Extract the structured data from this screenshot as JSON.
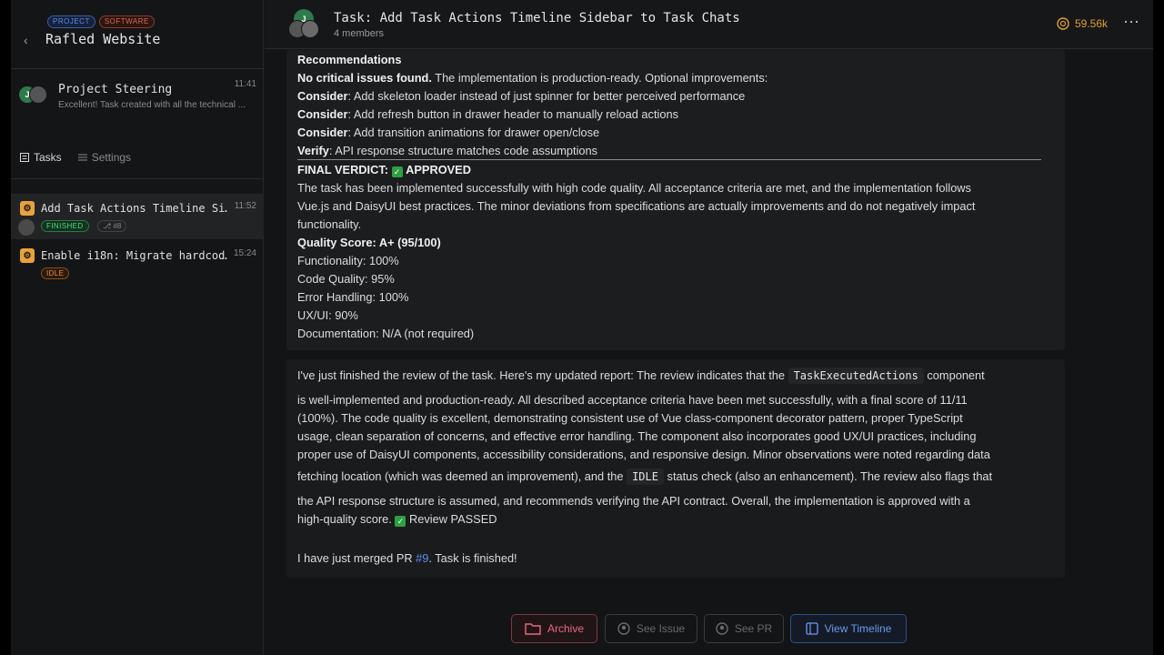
{
  "sidebar": {
    "chips": [
      "PROJECT",
      "SOFTWARE"
    ],
    "workspace_title": "Rafled Website",
    "steering": {
      "title": "Project Steering",
      "time": "11:41",
      "preview": "Excellent! Task created with all the technical ...",
      "avatar_initial": "J"
    },
    "tabs": [
      {
        "label": "Tasks"
      },
      {
        "label": "Settings"
      }
    ],
    "tasks": [
      {
        "title": "Add Task Actions Timeline Si…",
        "time": "11:52",
        "status": "FINISHED",
        "pr": "#8"
      },
      {
        "title": "Enable i18n: Migrate hardcod…",
        "time": "15:24",
        "status": "IDLE"
      }
    ]
  },
  "header": {
    "title": "Task: Add Task Actions Timeline Sidebar to Task Chats",
    "members": "4 members",
    "credits": "59.56k",
    "avatar_initial": "J"
  },
  "message1": {
    "recommendations_heading": "Recommendations",
    "no_issues_bold": "No critical issues found.",
    "no_issues_rest": " The implementation is production-ready. Optional improvements:",
    "items": [
      {
        "label": "Consider",
        "text": ": Add skeleton loader instead of just spinner for better perceived performance"
      },
      {
        "label": "Consider",
        "text": ": Add refresh button in drawer header to manually reload actions"
      },
      {
        "label": "Consider",
        "text": ": Add transition animations for drawer open/close"
      },
      {
        "label": "Verify",
        "text": ": API response structure matches code assumptions"
      }
    ],
    "verdict_label": "FINAL VERDICT:",
    "verdict_value": "APPROVED",
    "summary_lines": [
      "The task has been implemented successfully with high code quality. All acceptance criteria are met, and the implementation follows",
      "Vue.js and DaisyUI best practices. The minor deviations from specifications are actually improvements and do not negatively impact",
      "functionality."
    ],
    "quality_score": "Quality Score: A+ (95/100)",
    "scores": [
      "Functionality: 100%",
      "Code Quality: 95%",
      "Error Handling: 100%",
      "UX/UI: 90%",
      "Documentation: N/A (not required)"
    ]
  },
  "message2": {
    "l1_pre": "I've just finished the review of the task. Here's my updated report: The review indicates that the",
    "l1_code": "TaskExecutedActions",
    "l1_post": "component",
    "l2": "is well-implemented and production-ready. All described acceptance criteria have been met successfully, with a final score of 11/11",
    "l3": "(100%). The code quality is excellent, demonstrating consistent use of Vue class-component decorator pattern, proper TypeScript",
    "l4": "usage, clean separation of concerns, and effective error handling. The component also incorporates good UX/UI practices, including",
    "l5": "proper use of DaisyUI components, accessibility considerations, and responsive design. Minor observations were noted regarding data",
    "l6_pre": "fetching location (which was deemed an improvement), and the",
    "l6_code": "IDLE",
    "l6_post": "status check (also an enhancement). The review also flags that",
    "l7": "the API response structure is assumed, and recommends verifying the API contract. Overall, the implementation is approved with a",
    "l8_pre": "high-quality score.",
    "l8_post": "Review PASSED"
  },
  "message3": {
    "pre": "I have just merged PR ",
    "link": "#9",
    "post": ". Task is finished!"
  },
  "footer": {
    "archive": "Archive",
    "see_issue": "See Issue",
    "see_pr": "See PR",
    "view_timeline": "View Timeline"
  },
  "colors": {
    "accent_blue": "#5b8def",
    "finished_green": "#4ade80",
    "idle_orange": "#f08a3c",
    "archive_red": "#e86a7a",
    "credits_gold": "#e0a030"
  }
}
